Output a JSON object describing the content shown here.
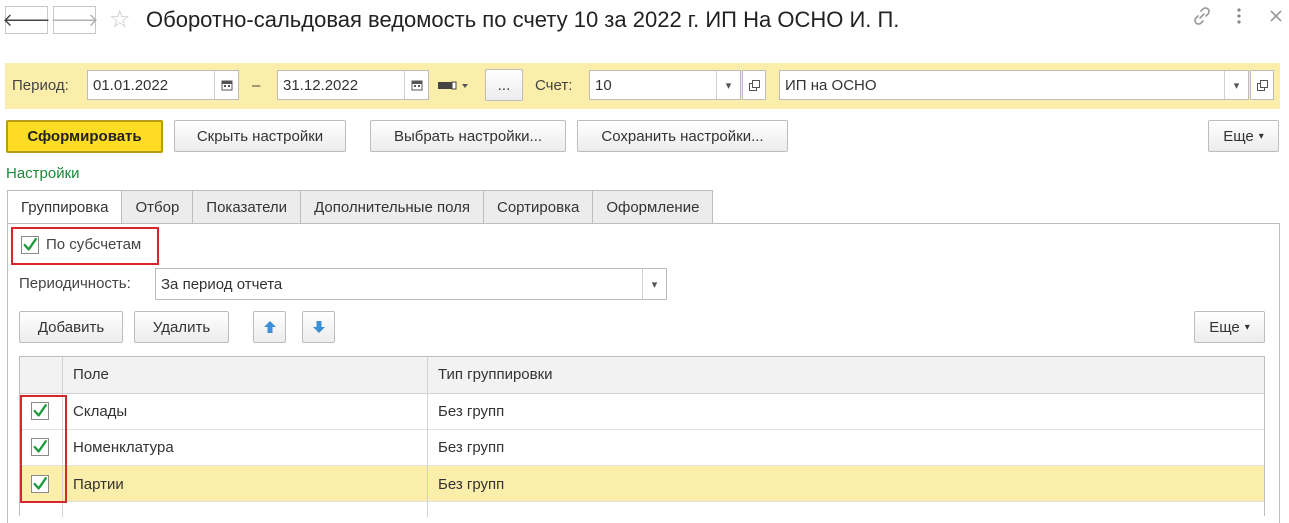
{
  "window": {
    "title": "Оборотно-сальдовая ведомость по счету 10 за 2022 г. ИП На ОСНО И. П.",
    "back_icon": "arrow-left-icon",
    "forward_icon": "arrow-right-icon",
    "favorite_icon": "star-icon",
    "tools": [
      "link-icon",
      "more-vertical-icon",
      "close-icon"
    ]
  },
  "params": {
    "period_label": "Период:",
    "date_from": "01.01.2022",
    "dash": "–",
    "date_to": "31.12.2022",
    "dots_label": "...",
    "account_label": "Счет:",
    "account_value": "10",
    "org_value": "ИП на ОСНО"
  },
  "toolbar": {
    "generate_label": "Сформировать",
    "hide_settings_label": "Скрыть настройки",
    "choose_settings_label": "Выбрать настройки...",
    "save_settings_label": "Сохранить настройки...",
    "more_label": "Еще"
  },
  "settings": {
    "link_label": "Настройки",
    "tabs": [
      "Группировка",
      "Отбор",
      "Показатели",
      "Дополнительные поля",
      "Сортировка",
      "Оформление"
    ],
    "active_tab": "Группировка",
    "by_subaccounts_label": "По субсчетам",
    "by_subaccounts_checked": true,
    "periodicity_label": "Периодичность:",
    "periodicity_value": "За период отчета",
    "add_label": "Добавить",
    "delete_label": "Удалить",
    "more_label": "Еще"
  },
  "grouping_table": {
    "columns": [
      "Поле",
      "Тип группировки"
    ],
    "rows": [
      {
        "field": "Склады",
        "type": "Без групп",
        "checked": true,
        "selected": false
      },
      {
        "field": "Номенклатура",
        "type": "Без групп",
        "checked": true,
        "selected": false
      },
      {
        "field": "Партии",
        "type": "Без групп",
        "checked": true,
        "selected": true
      }
    ]
  },
  "colors": {
    "accent_yellow": "#ffdc24",
    "panel_yellow": "#fbedaa",
    "check_green": "#1f9a3c",
    "highlight_red": "#d9262c",
    "link_green": "#1c8a3a"
  }
}
